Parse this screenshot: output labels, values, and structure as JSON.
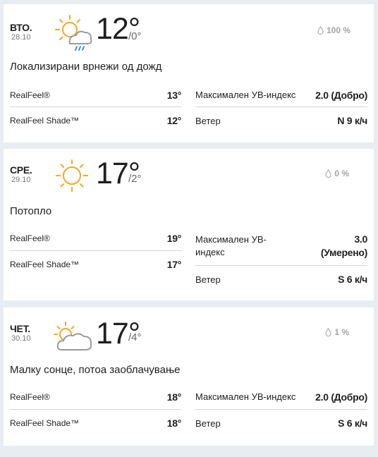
{
  "days": [
    {
      "day": "ВТО.",
      "date": "28.10",
      "icon": "sun-cloud-rain-icon",
      "temp": "12°",
      "low": "/0°",
      "precip": "100 %",
      "phrase": "Локализирани врнежи од дожд",
      "realfeel_label": "RealFeel®",
      "realfeel": "13°",
      "realfeel_shade_label": "RealFeel Shade™",
      "realfeel_shade": "12°",
      "uv_label": "Максимален УВ-индекс",
      "uv": "2.0 (Добро)",
      "wind_label": "Ветер",
      "wind": "N 9 к/ч"
    },
    {
      "day": "СРЕ.",
      "date": "29.10",
      "icon": "sun-icon",
      "temp": "17°",
      "low": "/2°",
      "precip": "0 %",
      "phrase": "Потопло",
      "realfeel_label": "RealFeel®",
      "realfeel": "19°",
      "realfeel_shade_label": "RealFeel Shade™",
      "realfeel_shade": "17°",
      "uv_label": "Максимален УВ-индекс",
      "uv_label_line1": "Максимален УВ-",
      "uv_label_line2": "индекс",
      "uv": "3.0",
      "uv_line1": "3.0",
      "uv_line2": "(Умерено)",
      "wind_label": "Ветер",
      "wind": "S 6 к/ч"
    },
    {
      "day": "ЧЕТ.",
      "date": "30.10",
      "icon": "sun-cloud-icon",
      "temp": "17°",
      "low": "/4°",
      "precip": "1 %",
      "phrase": "Малку сонце, потоа заоблачување",
      "realfeel_label": "RealFeel®",
      "realfeel": "18°",
      "realfeel_shade_label": "RealFeel Shade™",
      "realfeel_shade": "18°",
      "uv_label": "Максимален УВ-индекс",
      "uv": "2.0 (Добро)",
      "wind_label": "Ветер",
      "wind": "S 6 к/ч"
    }
  ],
  "colors": {
    "sun": "#f5a623",
    "cloud": "#9a9a9a",
    "rain": "#2c8ecf",
    "background": "#e8edf2",
    "card": "#ffffff"
  }
}
